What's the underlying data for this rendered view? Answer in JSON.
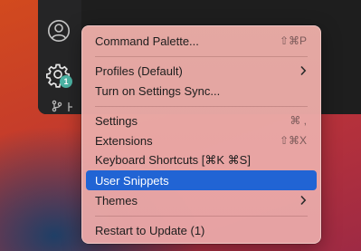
{
  "menu": {
    "items": [
      {
        "label": "Command Palette...",
        "shortcut": "⇧⌘P",
        "selected": false
      },
      {
        "label": "Profiles (Default)",
        "submenu": true,
        "selected": false
      },
      {
        "label": "Turn on Settings Sync...",
        "selected": false
      },
      {
        "label": "Settings",
        "shortcut": "⌘ ,",
        "selected": false
      },
      {
        "label": "Extensions",
        "shortcut": "⇧⌘X",
        "selected": false
      },
      {
        "label": "Keyboard Shortcuts [⌘K ⌘S]",
        "selected": false
      },
      {
        "label": "User Snippets",
        "selected": true
      },
      {
        "label": "Themes",
        "submenu": true,
        "selected": false
      },
      {
        "label": "Restart to Update (1)",
        "selected": false
      }
    ]
  },
  "activity_bar": {
    "icons": [
      "account-icon",
      "gear-icon"
    ],
    "manage_badge": "1"
  },
  "colors": {
    "selection": "#2164d4",
    "badge": "#4cb3a4",
    "menu_background": "#e9aaa6"
  }
}
